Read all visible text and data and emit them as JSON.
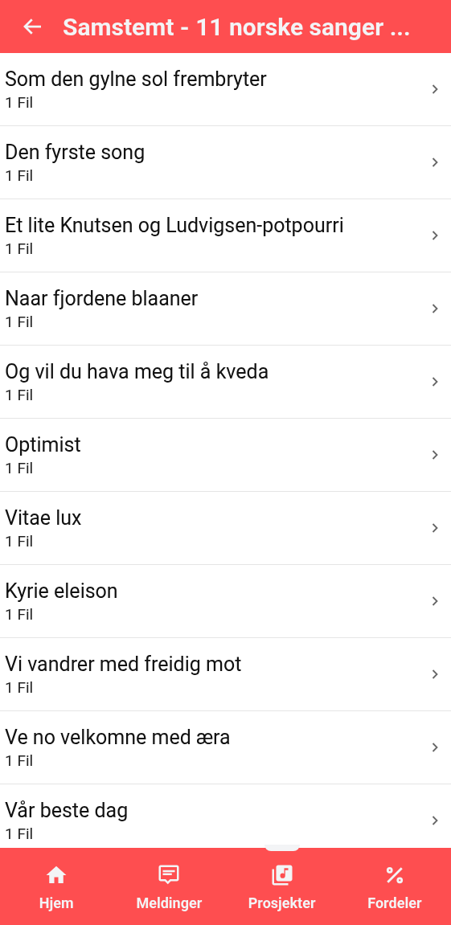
{
  "header": {
    "title": "Samstemt - 11 norske sanger ..."
  },
  "items": [
    {
      "title": "Som den gylne sol frembryter",
      "subtitle": "1 Fil"
    },
    {
      "title": "Den fyrste song",
      "subtitle": "1 Fil"
    },
    {
      "title": "Et lite Knutsen og Ludvigsen-potpourri",
      "subtitle": "1 Fil"
    },
    {
      "title": "Naar fjordene blaaner",
      "subtitle": "1 Fil"
    },
    {
      "title": "Og vil du hava meg til å kveda",
      "subtitle": "1 Fil"
    },
    {
      "title": "Optimist",
      "subtitle": "1 Fil"
    },
    {
      "title": "Vitae lux",
      "subtitle": "1 Fil"
    },
    {
      "title": "Kyrie eleison",
      "subtitle": "1 Fil"
    },
    {
      "title": "Vi vandrer med freidig mot",
      "subtitle": "1 Fil"
    },
    {
      "title": "Ve no velkomne med æra",
      "subtitle": "1 Fil"
    },
    {
      "title": "Vår beste dag",
      "subtitle": "1 Fil"
    }
  ],
  "nav": [
    {
      "kind": "home",
      "label": "Hjem",
      "selected": false
    },
    {
      "kind": "messages",
      "label": "Meldinger",
      "selected": false
    },
    {
      "kind": "projects",
      "label": "Prosjekter",
      "selected": true
    },
    {
      "kind": "benefits",
      "label": "Fordeler",
      "selected": false
    }
  ]
}
